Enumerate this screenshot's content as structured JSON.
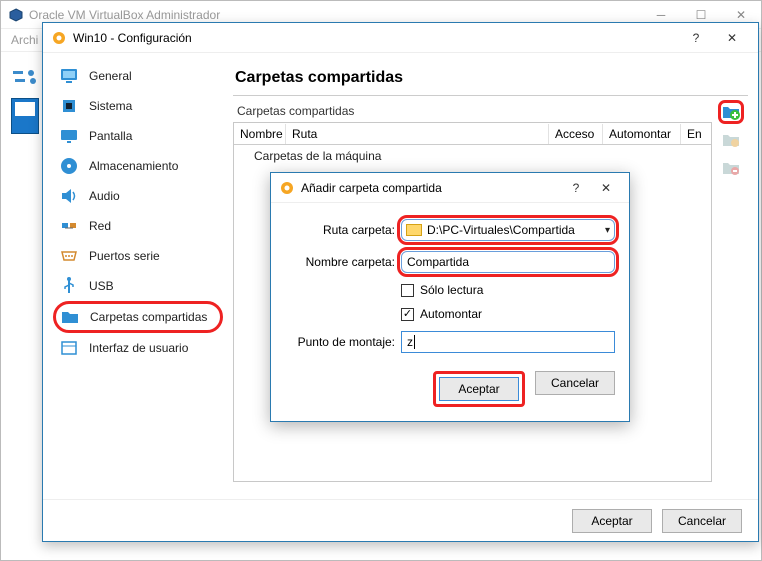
{
  "main_window": {
    "title": "Oracle VM VirtualBox Administrador",
    "menu_archivo": "Archi"
  },
  "settings": {
    "title": "Win10 - Configuración",
    "sidebar": {
      "items": [
        {
          "label": "General"
        },
        {
          "label": "Sistema"
        },
        {
          "label": "Pantalla"
        },
        {
          "label": "Almacenamiento"
        },
        {
          "label": "Audio"
        },
        {
          "label": "Red"
        },
        {
          "label": "Puertos serie"
        },
        {
          "label": "USB"
        },
        {
          "label": "Carpetas compartidas"
        },
        {
          "label": "Interfaz de usuario"
        }
      ]
    },
    "heading": "Carpetas compartidas",
    "subheading": "Carpetas compartidas",
    "table": {
      "cols": {
        "nombre": "Nombre",
        "ruta": "Ruta",
        "acceso": "Acceso",
        "automontar": "Automontar",
        "en": "En"
      },
      "group_row": "Carpetas de la máquina"
    },
    "footer": {
      "accept": "Aceptar",
      "cancel": "Cancelar"
    }
  },
  "add_dialog": {
    "title": "Añadir carpeta compartida",
    "labels": {
      "ruta": "Ruta carpeta:",
      "nombre": "Nombre carpeta:",
      "solo_lectura": "Sólo lectura",
      "automontar": "Automontar",
      "punto": "Punto de montaje:"
    },
    "values": {
      "ruta": "D:\\PC-Virtuales\\Compartida",
      "nombre": "Compartida",
      "solo_lectura_checked": false,
      "automontar_checked": true,
      "punto": "z"
    },
    "footer": {
      "accept": "Aceptar",
      "cancel": "Cancelar"
    }
  }
}
